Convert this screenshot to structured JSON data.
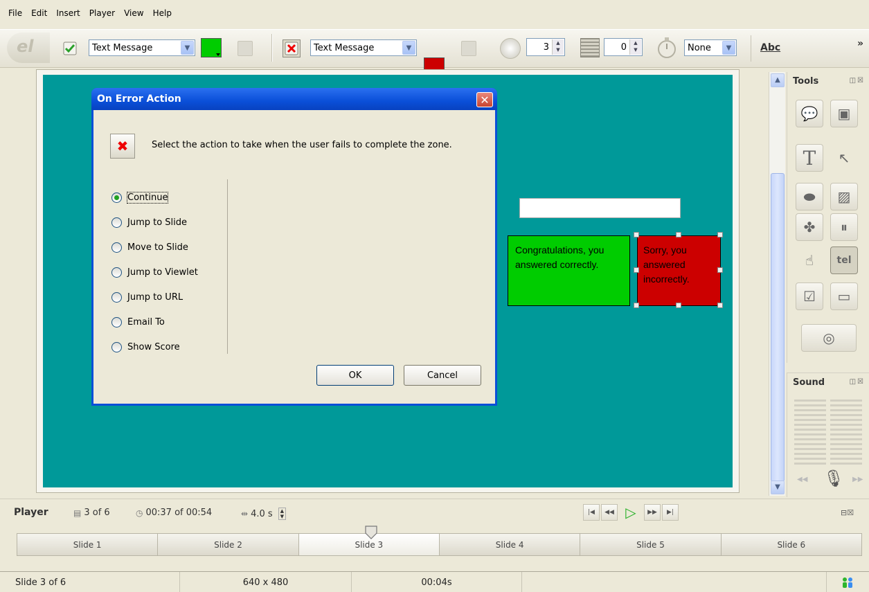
{
  "menu": [
    "File",
    "Edit",
    "Insert",
    "Player",
    "View",
    "Help"
  ],
  "toolbar": {
    "logo_text": "el",
    "success_action": "Text Message",
    "error_action": "Text Message",
    "success_color": "#00cc00",
    "error_color": "#cc0000",
    "attempts": "3",
    "score": "0",
    "timer": "None",
    "abc_label": "Abc",
    "overflow": "»"
  },
  "stage": {
    "bg_color": "#009999",
    "correct_message": "Congratulations, you answered correctly.",
    "incorrect_message": "Sorry, you answered incorrectly."
  },
  "dialog": {
    "title": "On Error Action",
    "close_glyph": "✕",
    "message": "Select the action to take when the user fails to complete the zone.",
    "options": [
      "Continue",
      "Jump to Slide",
      "Move to Slide",
      "Jump to Viewlet",
      "Jump to URL",
      "Email To",
      "Show Score"
    ],
    "selected": "Continue",
    "ok_label": "OK",
    "cancel_label": "Cancel"
  },
  "panels": {
    "tools_title": "Tools",
    "sound_title": "Sound"
  },
  "player": {
    "label": "Player",
    "slide_pos": "3 of 6",
    "time": "00:37 of 00:54",
    "duration": "4.0 s"
  },
  "timeline": {
    "slides": [
      "Slide 1",
      "Slide 2",
      "Slide 3",
      "Slide 4",
      "Slide 5",
      "Slide 6"
    ],
    "active_index": 2
  },
  "status": {
    "slide": "Slide 3 of 6",
    "size": "640 x 480",
    "time": "00:04s"
  }
}
